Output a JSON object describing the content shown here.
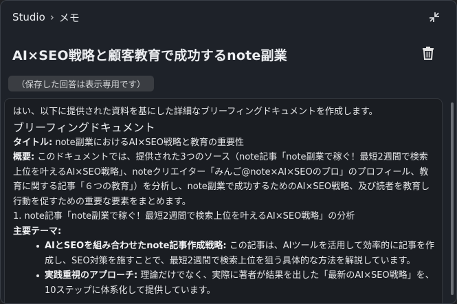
{
  "header": {
    "breadcrumb_root": "Studio",
    "breadcrumb_sep": "›",
    "breadcrumb_current": "メモ"
  },
  "note": {
    "title": "AI×SEO戦略と顧客教育で成功するnote副業",
    "readonly_label": "（保存した回答は表示専用です）"
  },
  "content": {
    "intro": "はい、以下に提供された資料を基にした詳細なブリーフィングドキュメントを作成します。",
    "heading": "ブリーフィングドキュメント",
    "title_label": "タイトル:",
    "title_value": " note副業におけるAI×SEO戦略と教育の重要性",
    "overview_label": "概要:",
    "overview_value": " このドキュメントでは、提供された3つのソース（note記事「note副業で稼ぐ！最短2週間で検索上位を叶えるAI×SEO戦略」、noteクリエイター「みんご@note×AI×SEOのプロ」のプロフィール、教育に関する記事「６つの教育」）を分析し、note副業で成功するためのAI×SEO戦略、及び読者を教育し行動を促すための重要な要素をまとめます。",
    "section1": "1. note記事「note副業で稼ぐ！最短2週間で検索上位を叶えるAI×SEO戦略」の分析",
    "themes_label": "主要テーマ:",
    "bullets": [
      {
        "label": "AIとSEOを組み合わせたnote記事作成戦略:",
        "text": " この記事は、AIツールを活用して効率的に記事を作成し、SEO対策を施すことで、最短2週間で検索上位を狙う具体的な方法を解説しています。"
      },
      {
        "label": "実践重視のアプローチ:",
        "text": " 理論だけでなく、実際に著者が結果を出した「最新のAI×SEO戦略」を、10ステップに体系化して提供しています。"
      }
    ]
  },
  "colors": {
    "background": "#1e2229",
    "content_background": "#1a1d22",
    "chip_background": "#3a3d42",
    "text": "#e6e7e9"
  },
  "icons": {
    "collapse": "collapse-arrows-icon",
    "delete": "trash-icon"
  }
}
